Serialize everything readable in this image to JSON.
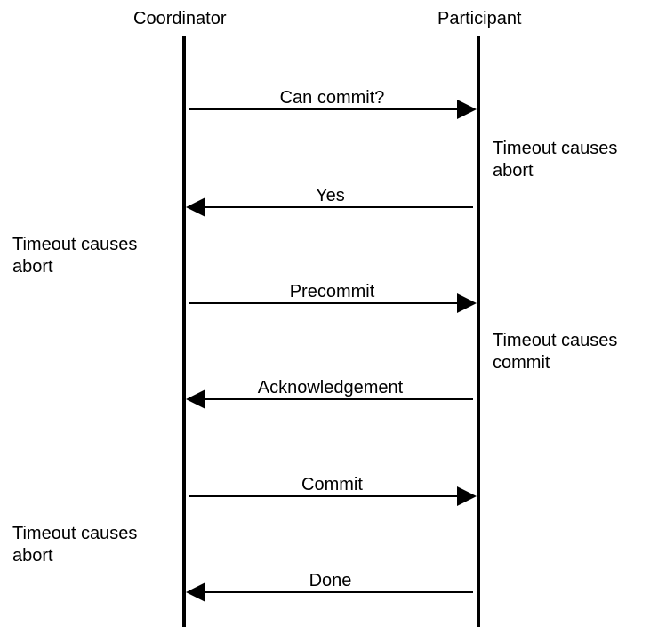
{
  "actors": {
    "coordinator": "Coordinator",
    "participant": "Participant"
  },
  "messages": [
    {
      "label": "Can commit?",
      "direction": "right"
    },
    {
      "label": "Yes",
      "direction": "left"
    },
    {
      "label": "Precommit",
      "direction": "right"
    },
    {
      "label": "Acknowledgement",
      "direction": "left"
    },
    {
      "label": "Commit",
      "direction": "right"
    },
    {
      "label": "Done",
      "direction": "left"
    }
  ],
  "notes": {
    "right1": "Timeout causes\nabort",
    "left1": "Timeout causes\nabort",
    "right2": "Timeout causes\ncommit",
    "left2": "Timeout causes\nabort"
  },
  "chart_data": {
    "type": "sequence-diagram",
    "actors": [
      "Coordinator",
      "Participant"
    ],
    "events": [
      {
        "from": "Coordinator",
        "to": "Participant",
        "message": "Can commit?"
      },
      {
        "note_at": "Participant",
        "text": "Timeout causes abort"
      },
      {
        "from": "Participant",
        "to": "Coordinator",
        "message": "Yes"
      },
      {
        "note_at": "Coordinator",
        "text": "Timeout causes abort"
      },
      {
        "from": "Coordinator",
        "to": "Participant",
        "message": "Precommit"
      },
      {
        "note_at": "Participant",
        "text": "Timeout causes commit"
      },
      {
        "from": "Participant",
        "to": "Coordinator",
        "message": "Acknowledgement"
      },
      {
        "from": "Coordinator",
        "to": "Participant",
        "message": "Commit"
      },
      {
        "note_at": "Coordinator",
        "text": "Timeout causes abort"
      },
      {
        "from": "Participant",
        "to": "Coordinator",
        "message": "Done"
      }
    ]
  }
}
